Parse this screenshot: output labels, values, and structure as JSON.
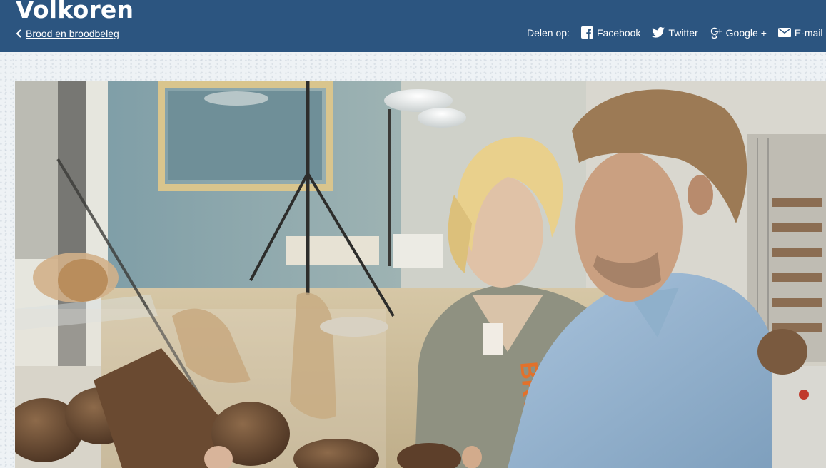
{
  "page": {
    "title": "Volkoren",
    "breadcrumb": {
      "label": "Brood en broodbeleg"
    }
  },
  "share": {
    "label": "Delen op:",
    "items": [
      {
        "id": "facebook",
        "label": "Facebook",
        "icon": "facebook-icon"
      },
      {
        "id": "twitter",
        "label": "Twitter",
        "icon": "twitter-icon"
      },
      {
        "id": "google",
        "label": "Google +",
        "icon": "google-plus-icon"
      },
      {
        "id": "email",
        "label": "E-mail",
        "icon": "envelope-icon"
      }
    ]
  },
  "media": {
    "image": "photo of a blond woman and a man in a light-blue shirt looking at wholemeal bread in a bakery display counter"
  },
  "colors": {
    "header": "#2c5580",
    "background": "#eef2f5",
    "text_on_header": "#ffffff"
  }
}
